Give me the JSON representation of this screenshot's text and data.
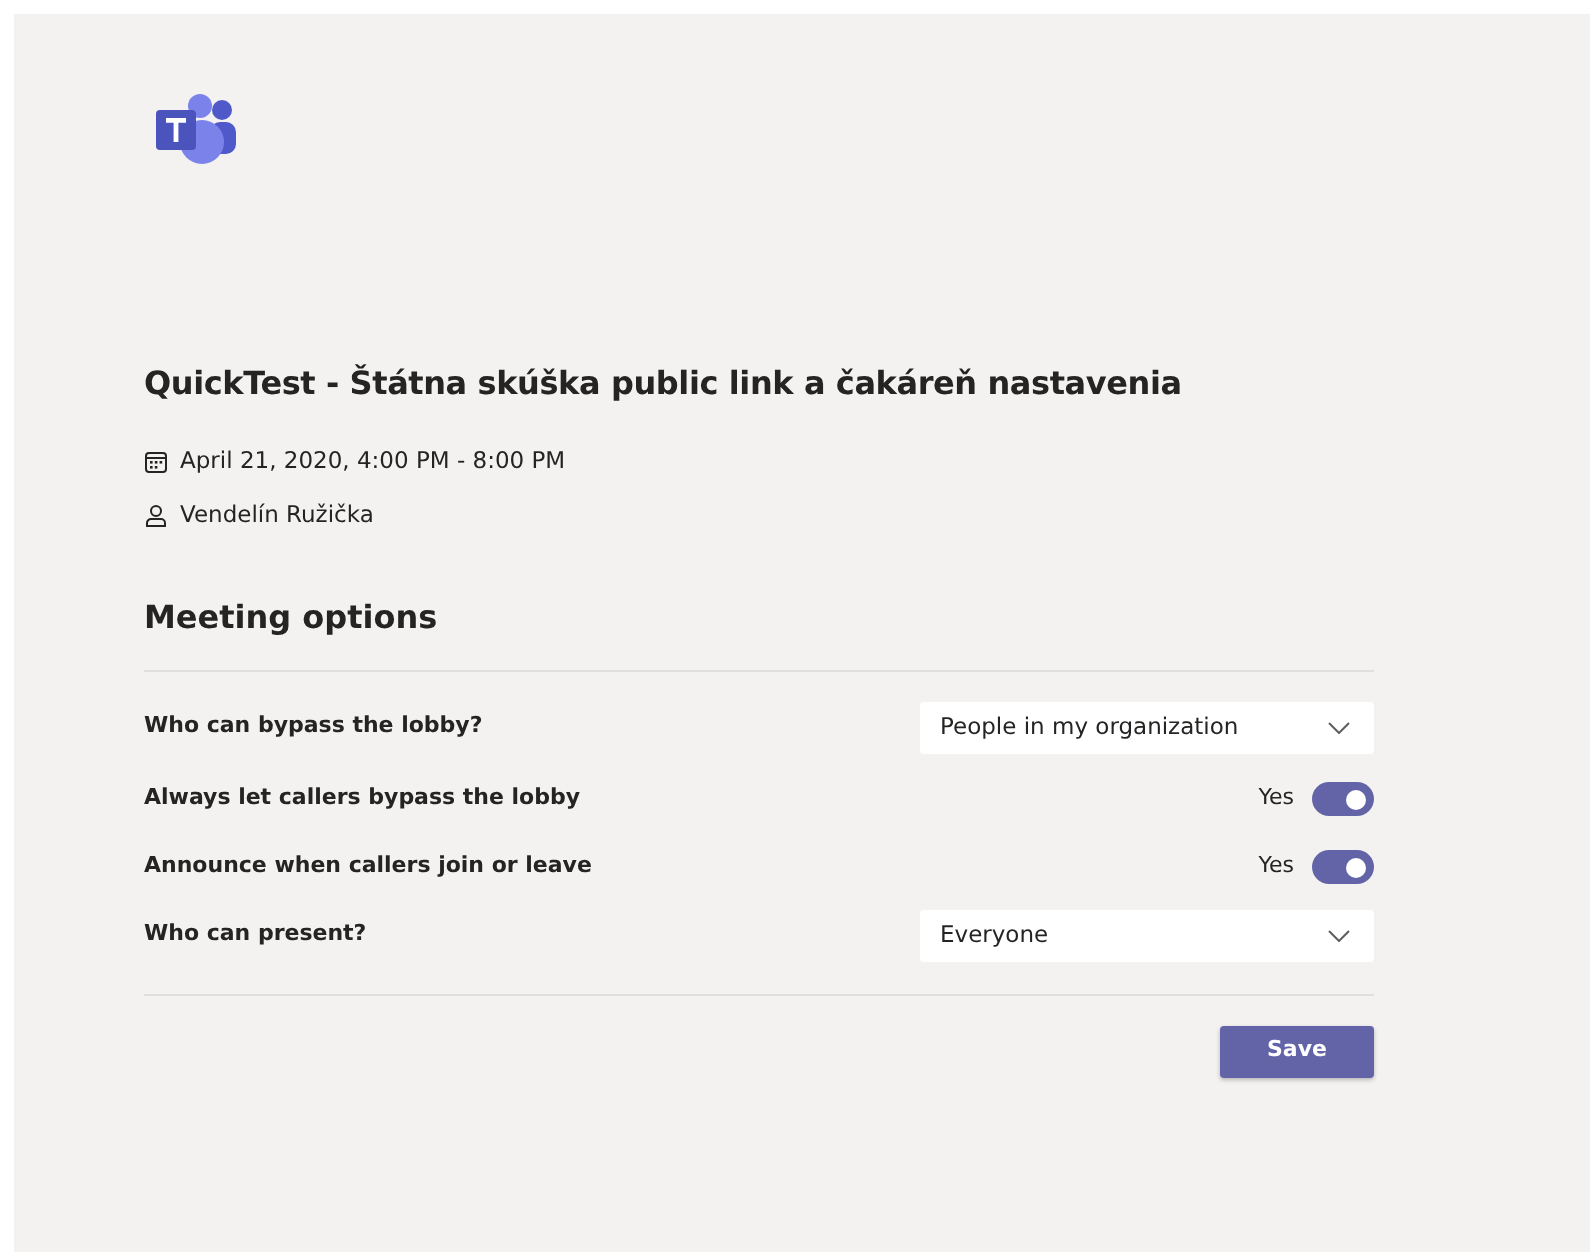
{
  "meeting": {
    "title": "QuickTest - Štátna skúška public link a čakáreň nastavenia",
    "date": "April 21, 2020, 4:00 PM - 8:00 PM",
    "organizer": "Vendelín Ružička"
  },
  "options_heading": "Meeting options",
  "options": [
    {
      "kind": "dropdown",
      "label": "Who can bypass the lobby?",
      "value": "People in my organization"
    },
    {
      "kind": "toggle",
      "label": "Always let callers bypass the lobby",
      "state_text": "Yes",
      "on": true
    },
    {
      "kind": "toggle",
      "label": "Announce when callers join or leave",
      "state_text": "Yes",
      "on": true
    },
    {
      "kind": "dropdown",
      "label": "Who can present?",
      "value": "Everyone"
    }
  ],
  "save_button": "Save"
}
